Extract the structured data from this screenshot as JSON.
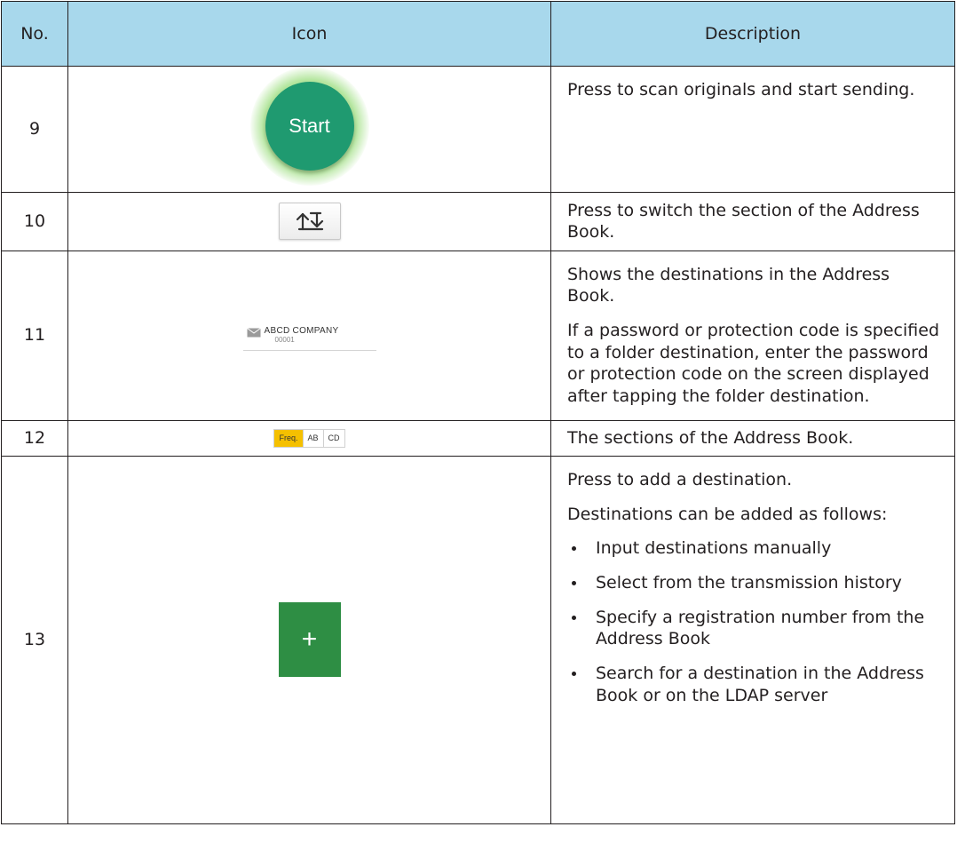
{
  "header": {
    "no": "No.",
    "icon": "Icon",
    "description": "Description"
  },
  "rows": [
    {
      "no": "9",
      "icon": {
        "name": "start-button",
        "label": "Start",
        "color": "#1f9a70"
      },
      "description": [
        "Press to scan originals and start sending."
      ]
    },
    {
      "no": "10",
      "icon": {
        "name": "switch-section-icon"
      },
      "description": [
        "Press to switch the section of the Address Book."
      ]
    },
    {
      "no": "11",
      "icon": {
        "name": "destination-item",
        "label": "ABCD COMPANY",
        "code": "00001"
      },
      "description": [
        "Shows the destinations in the Address Book.",
        "If a password or protection code is specified to a folder destination, enter the password or protection code on the screen displayed after tapping the folder destination."
      ]
    },
    {
      "no": "12",
      "icon": {
        "name": "address-book-sections",
        "tabs": [
          "Freq.",
          "AB",
          "CD"
        ],
        "active_color": "#f5c000"
      },
      "description": [
        "The sections of the Address Book."
      ]
    },
    {
      "no": "13",
      "icon": {
        "name": "add-destination-button",
        "label": "+",
        "color": "#2e8e44"
      },
      "description": [
        "Press to add a destination.",
        "Destinations can be added as follows:"
      ],
      "bullets": [
        "Input destinations manually",
        "Select from the transmission history",
        "Specify a registration number from the Address Book",
        "Search for a destination in the Address Book or on the LDAP server"
      ]
    }
  ]
}
